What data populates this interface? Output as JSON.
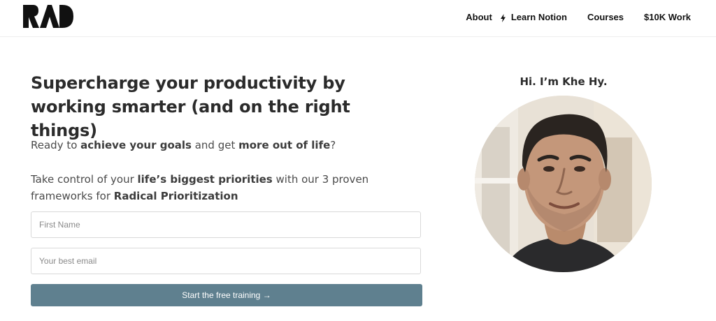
{
  "header": {
    "logo_text": "RAD",
    "nav": {
      "about": "About",
      "learn_notion": "Learn Notion",
      "courses": "Courses",
      "ten_k_work": "$10K Work"
    },
    "icons": {
      "learn_notion": "lightning-bolt-icon"
    }
  },
  "hero": {
    "headline": "Supercharge your productivity by working smarter (and on the right things)",
    "para1": {
      "t1": "Ready to ",
      "b1": "achieve your goals",
      "t2": " and get ",
      "b2": "more out of life",
      "t3": "?"
    },
    "para2": {
      "t1": "Take control of your ",
      "b1": "life’s biggest priorities",
      "t2": " with our 3 proven frameworks for ",
      "b2": "Radical Prioritization"
    },
    "form": {
      "first_name_placeholder": "First Name",
      "email_placeholder": "Your best email",
      "submit_label": "Start the free training →"
    }
  },
  "profile": {
    "greeting": "Hi. I’m Khe Hy."
  },
  "colors": {
    "cta_background": "#5f808f",
    "text_dark": "#2b2b2b",
    "input_border": "#d9d9d9"
  }
}
